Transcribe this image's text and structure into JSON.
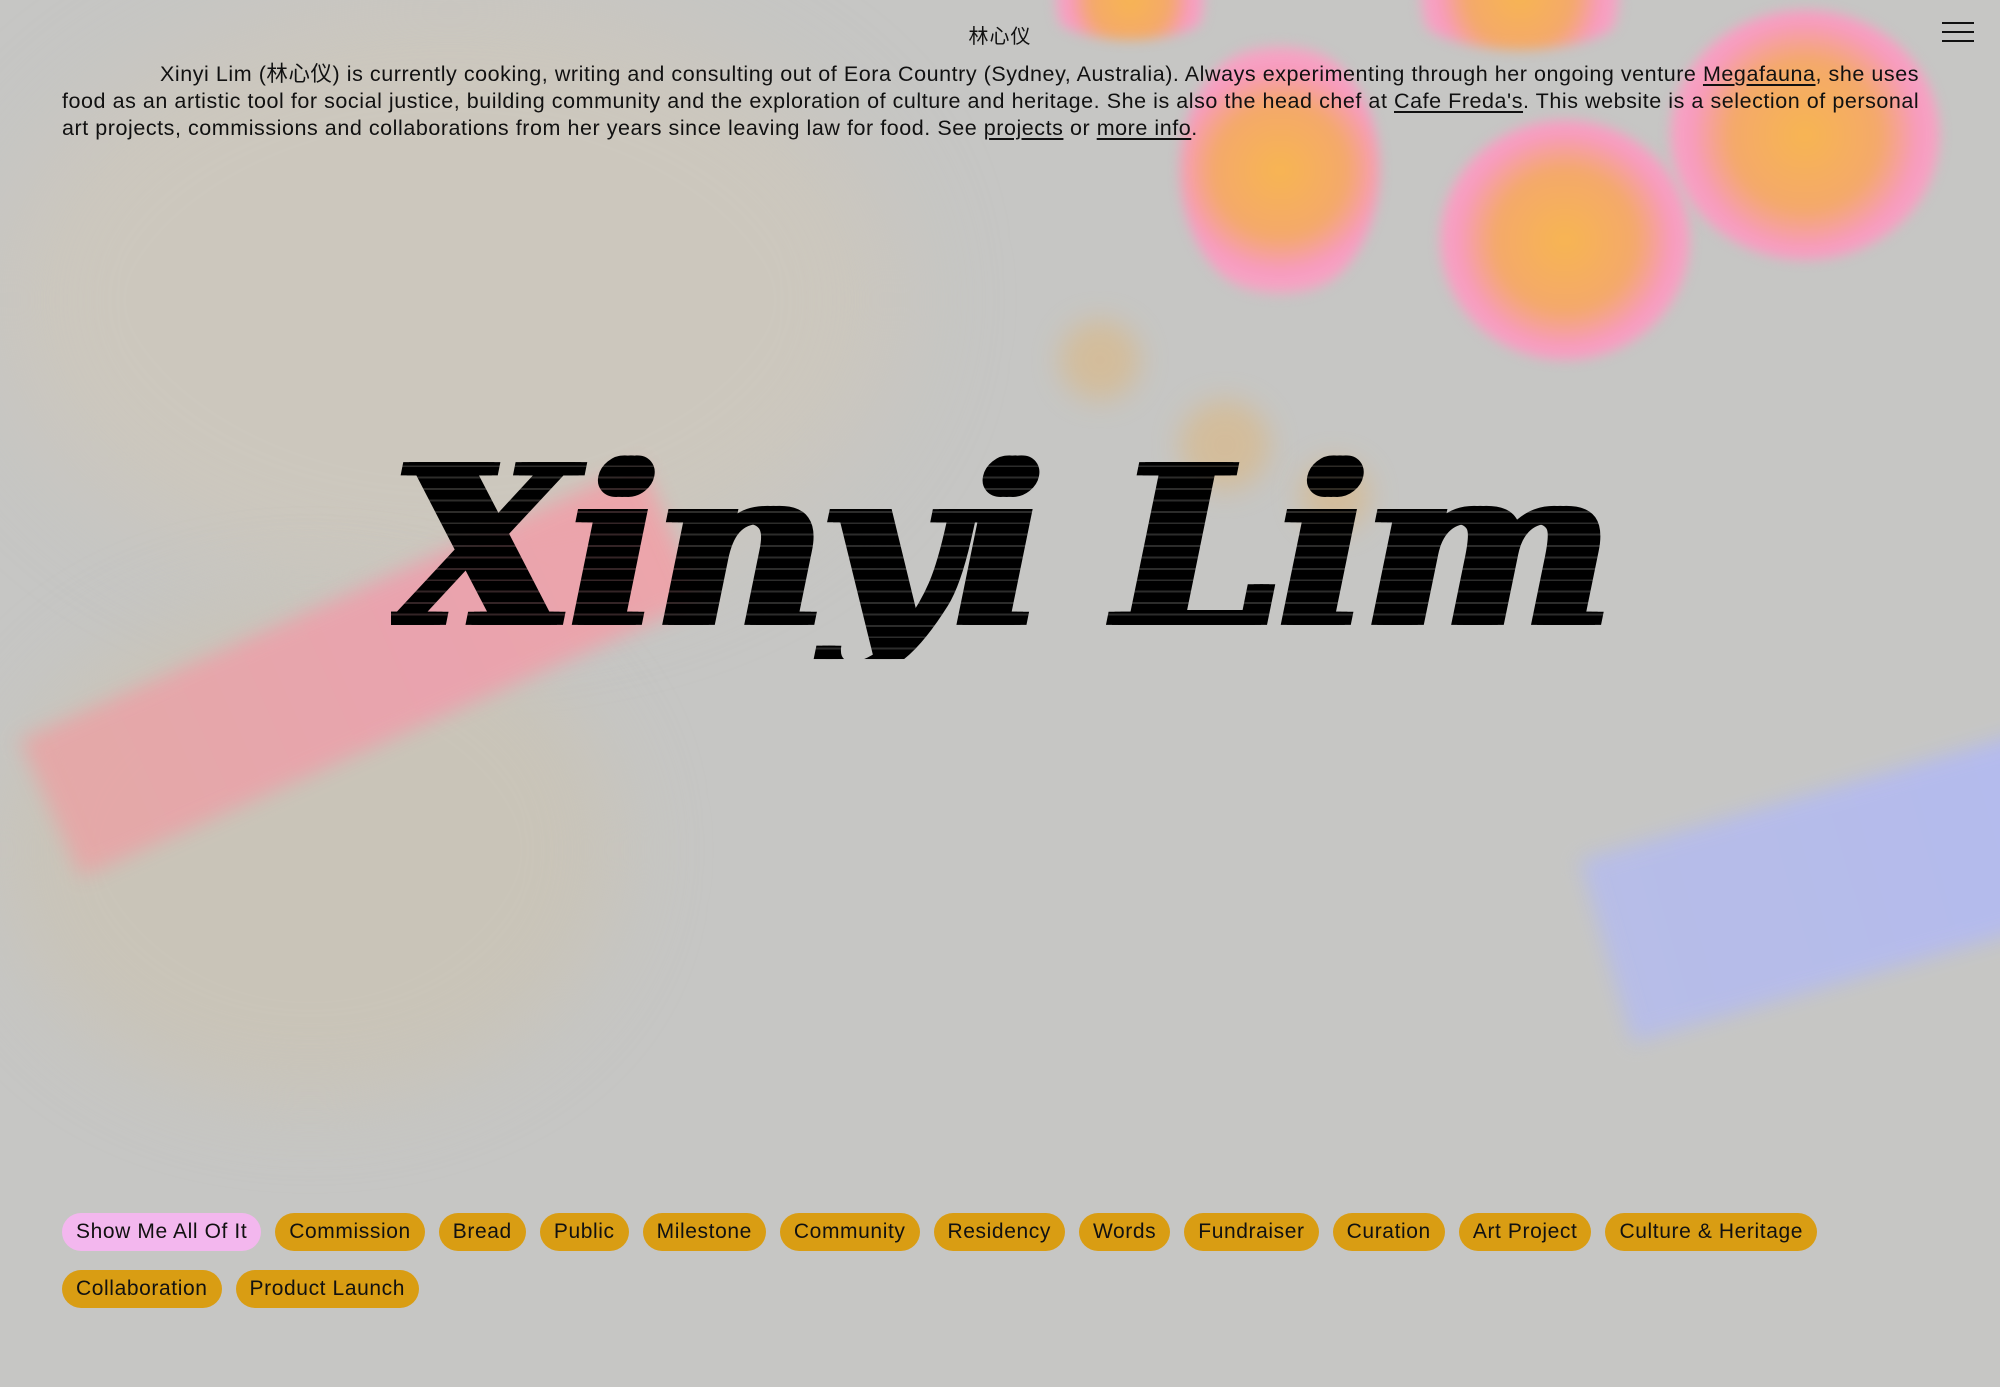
{
  "header": {
    "chinese_name": "林心仪",
    "menu_icon": "hamburger-menu-icon"
  },
  "intro": {
    "text_1": "Xinyi Lim (林心仪) is currently cooking, writing and consulting out of Eora Country (Sydney, Australia). Always experimenting through her ongoing venture ",
    "link_megafauna": "Megafauna",
    "text_2": ", she uses food as an artistic tool for social justice, building community and the exploration of culture and heritage. She is also the head chef at ",
    "link_cafe_fredas": "Cafe Freda's",
    "text_3": ". This website is a selection of personal art projects, commissions and collaborations from her years since leaving law for food. See ",
    "link_projects": "projects",
    "text_4": " or ",
    "link_more_info": "more info",
    "text_5": "."
  },
  "hero": {
    "title": "Xinyi Lim"
  },
  "filters": {
    "items": [
      {
        "label": "Show Me All Of It",
        "active": true
      },
      {
        "label": "Commission"
      },
      {
        "label": "Bread"
      },
      {
        "label": "Public"
      },
      {
        "label": "Milestone"
      },
      {
        "label": "Community"
      },
      {
        "label": "Residency"
      },
      {
        "label": "Words"
      },
      {
        "label": "Fundraiser"
      },
      {
        "label": "Curation"
      },
      {
        "label": "Art Project"
      },
      {
        "label": "Culture & Heritage"
      },
      {
        "label": "Collaboration"
      },
      {
        "label": "Product Launch"
      }
    ]
  },
  "colors": {
    "background": "#c6c6c4",
    "tag": "#d99d13",
    "tag_active": "#f3b7ee",
    "text": "#111111"
  }
}
